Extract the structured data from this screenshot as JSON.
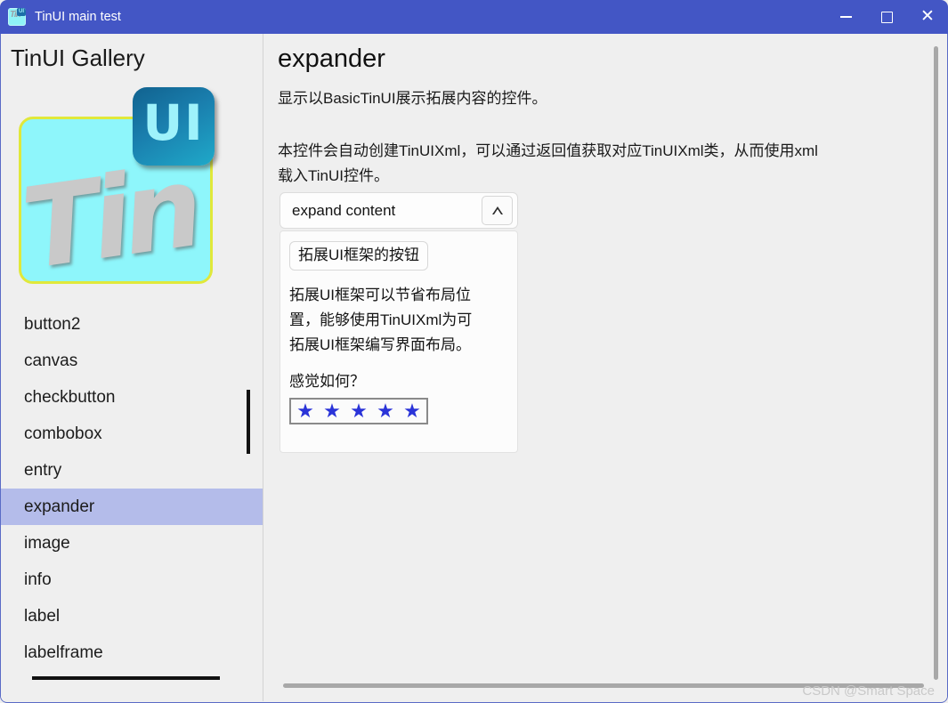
{
  "window": {
    "title": "TinUI main test",
    "icon": "tinui-app-icon",
    "controls": {
      "minimize": "—",
      "maximize": "□",
      "close": "✕"
    }
  },
  "sidebar": {
    "title": "TinUI Gallery",
    "logo": {
      "wordmark": "Tin",
      "badge": "UI",
      "square_color": "#8ef6fb",
      "border_color": "#e0e83a",
      "badge_color": "#1a7fae"
    },
    "selected": "expander",
    "items": [
      {
        "label": "button2",
        "selected": false
      },
      {
        "label": "canvas",
        "selected": false
      },
      {
        "label": "checkbutton",
        "selected": false
      },
      {
        "label": "combobox",
        "selected": false
      },
      {
        "label": "entry",
        "selected": false
      },
      {
        "label": "expander",
        "selected": true
      },
      {
        "label": "image",
        "selected": false
      },
      {
        "label": "info",
        "selected": false
      },
      {
        "label": "label",
        "selected": false
      },
      {
        "label": "labelframe",
        "selected": false
      }
    ],
    "highlight_color": "#b4bcea"
  },
  "main": {
    "heading": "expander",
    "description_line": "显示以BasicTinUI展示拓展内容的控件。",
    "description_block": "本控件会自动创建TinUIXml，可以通过返回值获取对应TinUIXml类，从而使用xml载入TinUI控件。",
    "expander": {
      "header_label": "expand content",
      "toggle_icon": "triangle-up-icon",
      "expanded": true,
      "inner_button_label": "拓展UI框架的按钮",
      "paragraph": "拓展UI框架可以节省布局位置，能够使用TinUIXml为可拓展UI框架编写界面布局。",
      "question": "感觉如何？",
      "rating": {
        "value": 5,
        "max": 5,
        "glyph": "★",
        "color": "#2a33d8"
      }
    }
  },
  "watermark": "CSDN @Smart Space",
  "theme": {
    "titlebar": "#4356c5",
    "window_bg": "#efefef",
    "border": "#5a6bc6",
    "scrollbar_dark": "#111111",
    "scrollbar_light": "#a8a8a8"
  }
}
